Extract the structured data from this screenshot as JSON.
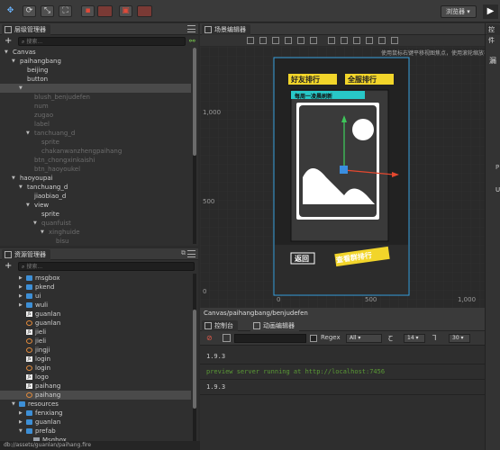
{
  "toolbar": {
    "browser_select": "浏览器",
    "play_icon": "play-icon"
  },
  "hierarchy": {
    "title": "层级管理器",
    "search_placeholder": "搜索...",
    "items": [
      {
        "label": "Canvas",
        "depth": 0,
        "arrow": "▼",
        "dim": false
      },
      {
        "label": "paihangbang",
        "depth": 1,
        "arrow": "▼",
        "dim": false
      },
      {
        "label": "beijing",
        "depth": 2,
        "arrow": "",
        "dim": false
      },
      {
        "label": "button",
        "depth": 2,
        "arrow": "",
        "dim": false
      },
      {
        "label": "",
        "depth": 2,
        "arrow": "▼",
        "dim": true,
        "selected": true
      },
      {
        "label": "blush_benjudefen",
        "depth": 3,
        "arrow": "",
        "dim": true
      },
      {
        "label": "num",
        "depth": 3,
        "arrow": "",
        "dim": true
      },
      {
        "label": "zugao",
        "depth": 3,
        "arrow": "",
        "dim": true
      },
      {
        "label": "label",
        "depth": 3,
        "arrow": "",
        "dim": true
      },
      {
        "label": "tanchuang_d",
        "depth": 3,
        "arrow": "▼",
        "dim": true
      },
      {
        "label": "sprite",
        "depth": 4,
        "arrow": "",
        "dim": true
      },
      {
        "label": "chakanwanzhengpaihang",
        "depth": 4,
        "arrow": "",
        "dim": true
      },
      {
        "label": "btn_chongxinkaishi",
        "depth": 3,
        "arrow": "",
        "dim": true
      },
      {
        "label": "btn_haoyoukel",
        "depth": 3,
        "arrow": "",
        "dim": true
      },
      {
        "label": "haoyoupai",
        "depth": 1,
        "arrow": "▼",
        "dim": false
      },
      {
        "label": "tanchuang_d",
        "depth": 2,
        "arrow": "▼",
        "dim": false
      },
      {
        "label": "jiaobiao_d",
        "depth": 3,
        "arrow": "",
        "dim": false
      },
      {
        "label": "view",
        "depth": 3,
        "arrow": "▼",
        "dim": false
      },
      {
        "label": "sprite",
        "depth": 4,
        "arrow": "",
        "dim": false
      },
      {
        "label": "quanfuist",
        "depth": 4,
        "arrow": "▼",
        "dim": true
      },
      {
        "label": "xinghuide",
        "depth": 5,
        "arrow": "▼",
        "dim": true
      },
      {
        "label": "bisu",
        "depth": 6,
        "arrow": "",
        "dim": true
      },
      {
        "label": "weikung",
        "depth": 6,
        "arrow": "▼",
        "dim": true
      }
    ]
  },
  "assets": {
    "title": "资源管理器",
    "search_placeholder": "搜索...",
    "items": [
      {
        "label": "msgbox",
        "depth": 2,
        "arrow": "▶",
        "type": "folder"
      },
      {
        "label": "pkend",
        "depth": 2,
        "arrow": "▶",
        "type": "folder"
      },
      {
        "label": "ui",
        "depth": 2,
        "arrow": "▶",
        "type": "folder"
      },
      {
        "label": "wuli",
        "depth": 2,
        "arrow": "▶",
        "type": "folder"
      },
      {
        "label": "guanlan",
        "depth": 2,
        "arrow": "",
        "type": "js"
      },
      {
        "label": "guanlan",
        "depth": 2,
        "arrow": "",
        "type": "fire"
      },
      {
        "label": "jieli",
        "depth": 2,
        "arrow": "",
        "type": "js"
      },
      {
        "label": "jieli",
        "depth": 2,
        "arrow": "",
        "type": "fire"
      },
      {
        "label": "jingji",
        "depth": 2,
        "arrow": "",
        "type": "fire"
      },
      {
        "label": "login",
        "depth": 2,
        "arrow": "",
        "type": "js"
      },
      {
        "label": "login",
        "depth": 2,
        "arrow": "",
        "type": "fire"
      },
      {
        "label": "logo",
        "depth": 2,
        "arrow": "",
        "type": "js"
      },
      {
        "label": "paihang",
        "depth": 2,
        "arrow": "",
        "type": "js"
      },
      {
        "label": "paihang",
        "depth": 2,
        "arrow": "",
        "type": "fire",
        "selected": true
      },
      {
        "label": "resources",
        "depth": 1,
        "arrow": "▼",
        "type": "folder"
      },
      {
        "label": "fenxiang",
        "depth": 2,
        "arrow": "▶",
        "type": "folder"
      },
      {
        "label": "guanlan",
        "depth": 2,
        "arrow": "▶",
        "type": "folder"
      },
      {
        "label": "prefab",
        "depth": 2,
        "arrow": "▼",
        "type": "folder"
      },
      {
        "label": "Msgbox",
        "depth": 3,
        "arrow": "",
        "type": "prefab"
      }
    ]
  },
  "status_path": "db://assets/guanlan/paihang.fire",
  "scene": {
    "title": "场景编辑器",
    "hint": "使用鼠标右键平移视图焦点，使用滚轮缩放视图",
    "y_labels": [
      "1,000",
      "500",
      "0"
    ],
    "x_labels": [
      "0",
      "500",
      "1,000"
    ],
    "game_tabs": [
      "好友排行",
      "全服排行"
    ],
    "banner": "每周一凌晨刷新",
    "back_label": "返回",
    "rank_label": "查看群排行"
  },
  "breadcrumb": "Canvas/paihangbang/benjudefen",
  "console": {
    "tab_console": "控制台",
    "tab_animation": "动画编辑器",
    "regex_label": "Regex",
    "level_select": "All",
    "font_size": "14",
    "line_height": "30",
    "lines": [
      "1.9.3",
      "preview server running at http://localhost:7456",
      "1.9.3"
    ],
    "colors": {
      "info": "#cfcfcf",
      "success": "#5a9a35"
    }
  },
  "inspector": {
    "title": "控件",
    "side_chars": [
      "漏",
      "P",
      "U"
    ]
  },
  "colors": {
    "accent": "#3d8fd6",
    "panel_bg": "#2f2f2f",
    "gizmo_green": "#3ec65a",
    "gizmo_red": "#e5482f"
  }
}
